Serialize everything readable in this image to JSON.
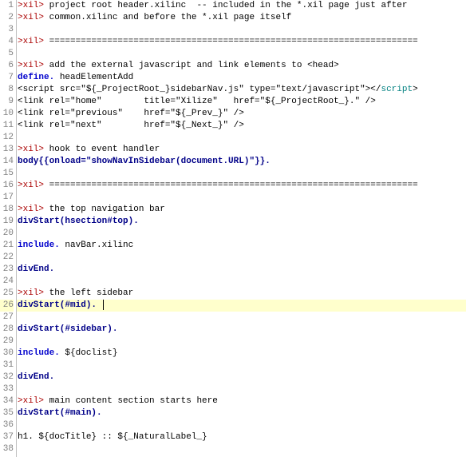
{
  "editor": {
    "current_line": 26,
    "lines": [
      {
        "n": 1,
        "segs": [
          {
            "c": "t-red",
            "t": ">xil>"
          },
          {
            "c": "t-black",
            "t": " project root header.xilinc  -- included in the *.xil page just after"
          }
        ]
      },
      {
        "n": 2,
        "segs": [
          {
            "c": "t-red",
            "t": ">xil>"
          },
          {
            "c": "t-black",
            "t": " common.xilinc and before the *.xil page itself"
          }
        ]
      },
      {
        "n": 3,
        "segs": []
      },
      {
        "n": 4,
        "segs": [
          {
            "c": "t-red",
            "t": ">xil>"
          },
          {
            "c": "t-black",
            "t": " ======================================================================"
          }
        ]
      },
      {
        "n": 5,
        "segs": []
      },
      {
        "n": 6,
        "segs": [
          {
            "c": "t-red",
            "t": ">xil>"
          },
          {
            "c": "t-black",
            "t": " add the external javascript and link elements to <head>"
          }
        ]
      },
      {
        "n": 7,
        "segs": [
          {
            "c": "t-blue",
            "t": "define."
          },
          {
            "c": "t-black",
            "t": " headElementAdd"
          }
        ]
      },
      {
        "n": 8,
        "segs": [
          {
            "c": "t-black",
            "t": "<script src=\"${_ProjectRoot_}sidebarNav.js\" type=\"text/javascript\"></"
          },
          {
            "c": "t-teal",
            "t": "script"
          },
          {
            "c": "t-black",
            "t": ">"
          }
        ]
      },
      {
        "n": 9,
        "segs": [
          {
            "c": "t-black",
            "t": "<link rel=\"home\"        title=\"Xilize\"   href=\"${_ProjectRoot_}.\" />"
          }
        ]
      },
      {
        "n": 10,
        "segs": [
          {
            "c": "t-black",
            "t": "<link rel=\"previous\"    href=\"${_Prev_}\" />"
          }
        ]
      },
      {
        "n": 11,
        "segs": [
          {
            "c": "t-black",
            "t": "<link rel=\"next\"        href=\"${_Next_}\" />"
          }
        ]
      },
      {
        "n": 12,
        "segs": []
      },
      {
        "n": 13,
        "segs": [
          {
            "c": "t-red",
            "t": ">xil>"
          },
          {
            "c": "t-black",
            "t": " hook to event handler"
          }
        ]
      },
      {
        "n": 14,
        "segs": [
          {
            "c": "t-darkblue",
            "t": "body{{onload=\"showNavInSidebar(document.URL)\"}}."
          }
        ]
      },
      {
        "n": 15,
        "segs": []
      },
      {
        "n": 16,
        "segs": [
          {
            "c": "t-red",
            "t": ">xil>"
          },
          {
            "c": "t-black",
            "t": " ======================================================================"
          }
        ]
      },
      {
        "n": 17,
        "segs": []
      },
      {
        "n": 18,
        "segs": [
          {
            "c": "t-red",
            "t": ">xil>"
          },
          {
            "c": "t-black",
            "t": " the top navigation bar"
          }
        ]
      },
      {
        "n": 19,
        "segs": [
          {
            "c": "t-darkblue",
            "t": "divStart(hsection#top)."
          }
        ]
      },
      {
        "n": 20,
        "segs": []
      },
      {
        "n": 21,
        "segs": [
          {
            "c": "t-blue",
            "t": "include."
          },
          {
            "c": "t-black",
            "t": " navBar.xilinc"
          }
        ]
      },
      {
        "n": 22,
        "segs": []
      },
      {
        "n": 23,
        "segs": [
          {
            "c": "t-darkblue",
            "t": "divEnd."
          }
        ]
      },
      {
        "n": 24,
        "segs": []
      },
      {
        "n": 25,
        "segs": [
          {
            "c": "t-red",
            "t": ">xil>"
          },
          {
            "c": "t-black",
            "t": " the left sidebar"
          }
        ]
      },
      {
        "n": 26,
        "segs": [
          {
            "c": "t-darkblue",
            "t": "divStart(#mid)."
          },
          {
            "c": "t-black",
            "t": " "
          }
        ],
        "caret": true
      },
      {
        "n": 27,
        "segs": []
      },
      {
        "n": 28,
        "segs": [
          {
            "c": "t-darkblue",
            "t": "divStart(#sidebar)."
          }
        ]
      },
      {
        "n": 29,
        "segs": []
      },
      {
        "n": 30,
        "segs": [
          {
            "c": "t-blue",
            "t": "include."
          },
          {
            "c": "t-black",
            "t": " ${doclist}"
          }
        ]
      },
      {
        "n": 31,
        "segs": []
      },
      {
        "n": 32,
        "segs": [
          {
            "c": "t-darkblue",
            "t": "divEnd."
          }
        ]
      },
      {
        "n": 33,
        "segs": []
      },
      {
        "n": 34,
        "segs": [
          {
            "c": "t-red",
            "t": ">xil>"
          },
          {
            "c": "t-black",
            "t": " main content section starts here"
          }
        ]
      },
      {
        "n": 35,
        "segs": [
          {
            "c": "t-darkblue",
            "t": "divStart(#main)."
          }
        ]
      },
      {
        "n": 36,
        "segs": []
      },
      {
        "n": 37,
        "segs": [
          {
            "c": "t-black",
            "t": "h1. ${docTitle} :: ${_NaturalLabel_}"
          }
        ]
      },
      {
        "n": 38,
        "segs": []
      }
    ]
  }
}
